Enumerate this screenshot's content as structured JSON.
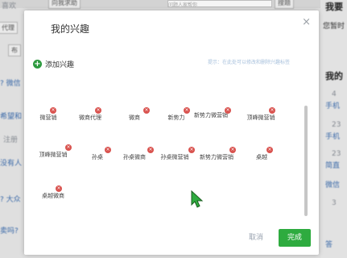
{
  "background": {
    "top_left": "喜欢",
    "top_button": "向我求助",
    "search_placeholder": "问题人家帮你",
    "search_button": "搜题",
    "right_top": "我要",
    "right_sub": "您暂时",
    "left_button": "代理",
    "left_button2": "布",
    "left_items": [
      "? 微信",
      "希望和",
      "注册",
      "没有人",
      "? 大众",
      "卖吗?"
    ],
    "right_heading": "我的",
    "right_items": [
      "4",
      "手机",
      "23",
      "手机",
      "23",
      "简直",
      "微信",
      "3",
      "答"
    ]
  },
  "modal": {
    "title": "我的兴趣",
    "close_icon": "×",
    "add_label": "添加兴趣",
    "hint": "提示：在此处可以修改和删除兴趣标签",
    "tags": [
      "微营销",
      "微商代理",
      "微商",
      "新势力",
      "新势力微营销",
      "顶峰微营销",
      "顶峰微营销",
      "孙桌",
      "孙桌微商",
      "孙桌微营销",
      "新势力微营销",
      "桌越",
      "桌越微商"
    ],
    "cancel_label": "取消",
    "done_label": "完成"
  },
  "colors": {
    "accent_green": "#2eab3f",
    "remove_red": "#d9534f"
  }
}
